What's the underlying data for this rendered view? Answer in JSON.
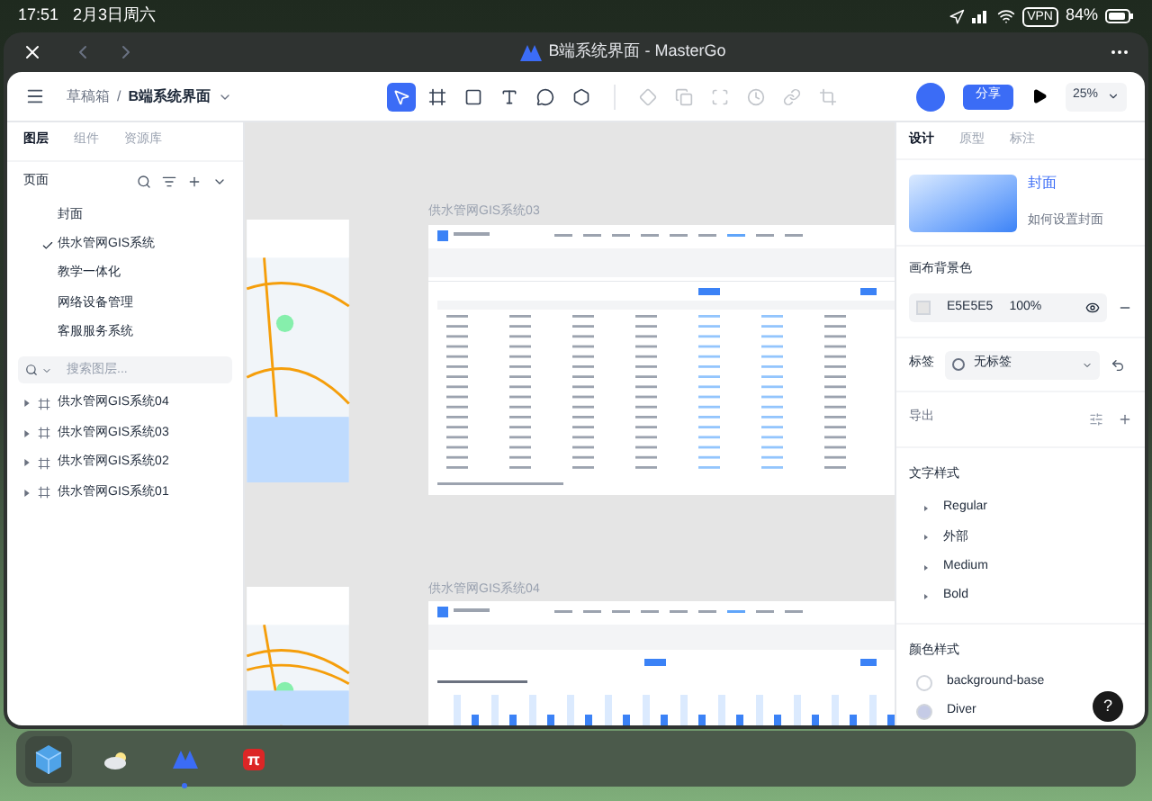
{
  "status_bar": {
    "time": "17:51",
    "date": "2月3日周六",
    "vpn": "VPN",
    "battery": "84%"
  },
  "app_header": {
    "title": "B端系统界面 - MasterGo"
  },
  "toolbar": {
    "breadcrumb": [
      "草稿箱",
      "B端系统界面"
    ],
    "separator": "/",
    "tools": [
      {
        "kind": "pointer",
        "selected": true,
        "disabled": false
      },
      {
        "kind": "frame",
        "selected": false,
        "disabled": false
      },
      {
        "kind": "rect",
        "selected": false,
        "disabled": false
      },
      {
        "kind": "text",
        "selected": false,
        "disabled": false
      },
      {
        "kind": "bubble",
        "selected": false,
        "disabled": false
      },
      {
        "kind": "plugin",
        "selected": false,
        "disabled": false
      },
      {
        "kind": "component",
        "selected": false,
        "disabled": true
      },
      {
        "kind": "copy",
        "selected": false,
        "disabled": true
      },
      {
        "kind": "mask",
        "selected": false,
        "disabled": true
      },
      {
        "kind": "clock",
        "selected": false,
        "disabled": true
      },
      {
        "kind": "link",
        "selected": false,
        "disabled": true
      },
      {
        "kind": "crop",
        "selected": false,
        "disabled": true
      }
    ],
    "share": "分享",
    "zoom": "25%"
  },
  "left_panel": {
    "tabs": [
      {
        "label": "图层",
        "selected": true
      },
      {
        "label": "组件",
        "selected": false
      },
      {
        "label": "资源库",
        "selected": false
      }
    ],
    "pages_title": "页面",
    "pages": [
      {
        "label": "封面",
        "checked": false
      },
      {
        "label": "供水管网GIS系统",
        "checked": true
      },
      {
        "label": "教学一体化",
        "checked": false
      },
      {
        "label": "网络设备管理",
        "checked": false
      },
      {
        "label": "客服服务系统",
        "checked": false
      }
    ],
    "search": {
      "placeholder": "搜索图层..."
    },
    "layers": [
      {
        "label": "供水管网GIS系统04",
        "expanded": false
      },
      {
        "label": "供水管网GIS系统03",
        "expanded": false
      },
      {
        "label": "供水管网GIS系统02",
        "expanded": false
      },
      {
        "label": "供水管网GIS系统01",
        "expanded": false
      }
    ]
  },
  "canvas": {
    "frames": [
      {
        "label": "供水管网GIS系统03",
        "kind": "table"
      },
      {
        "label": "供水管网GIS系统04",
        "kind": "chart"
      }
    ]
  },
  "right_panel": {
    "tabs": [
      {
        "label": "设计",
        "selected": true
      },
      {
        "label": "原型",
        "selected": false
      },
      {
        "label": "标注",
        "selected": false
      }
    ],
    "cover": {
      "title": "封面",
      "help": "如何设置封面"
    },
    "background": {
      "title": "画布背景色",
      "hex": "E5E5E5",
      "opacity": "100%"
    },
    "tag": {
      "label": "标签",
      "value": "无标签"
    },
    "export": {
      "label": "导出"
    },
    "text_styles": {
      "title": "文字样式",
      "items": [
        {
          "label": "Regular",
          "expanded": false
        },
        {
          "label": "外部",
          "expanded": false
        },
        {
          "label": "Medium",
          "expanded": false
        },
        {
          "label": "Bold",
          "expanded": false
        }
      ]
    },
    "color_styles": {
      "title": "颜色样式",
      "items": [
        {
          "label": "background-base",
          "color": "#ffffff"
        },
        {
          "label": "Diver",
          "color": "#c5cbe6"
        }
      ]
    },
    "help": "?"
  },
  "dock": {
    "apps": [
      {
        "kind": "cube",
        "running": false
      },
      {
        "kind": "weather",
        "running": false
      },
      {
        "kind": "mastergo",
        "running": true
      },
      {
        "kind": "pi",
        "running": false,
        "label": "π"
      }
    ]
  }
}
